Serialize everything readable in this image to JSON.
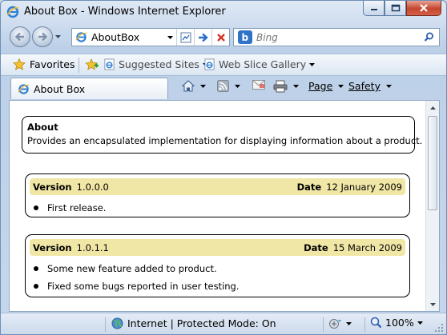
{
  "window": {
    "title": "About Box - Windows Internet Explorer"
  },
  "address_bar": {
    "url": "AboutBox",
    "search_placeholder": "Bing"
  },
  "favorites_bar": {
    "favorites_label": "Favorites",
    "links": [
      {
        "label": "Suggested Sites"
      },
      {
        "label": "Web Slice Gallery"
      }
    ]
  },
  "tab": {
    "label": "About Box"
  },
  "command_bar": {
    "page_label": "Page",
    "safety_label": "Safety"
  },
  "about": {
    "title": "About",
    "description": "Provides an encapsulated implementation for displaying information about a product."
  },
  "versions": [
    {
      "version_label": "Version",
      "version": "1.0.0.0",
      "date_label": "Date",
      "date": "12 January 2009",
      "changes": [
        "First release."
      ]
    },
    {
      "version_label": "Version",
      "version": "1.0.1.1",
      "date_label": "Date",
      "date": "15 March 2009",
      "changes": [
        "Some new feature added to product.",
        "Fixed some bugs reported in user testing."
      ]
    }
  ],
  "status_bar": {
    "zone": "Internet | Protected Mode: On",
    "zoom": "100%"
  },
  "colors": {
    "version_header_bg": "#f0e6a6",
    "close_button": "#c4462e"
  }
}
